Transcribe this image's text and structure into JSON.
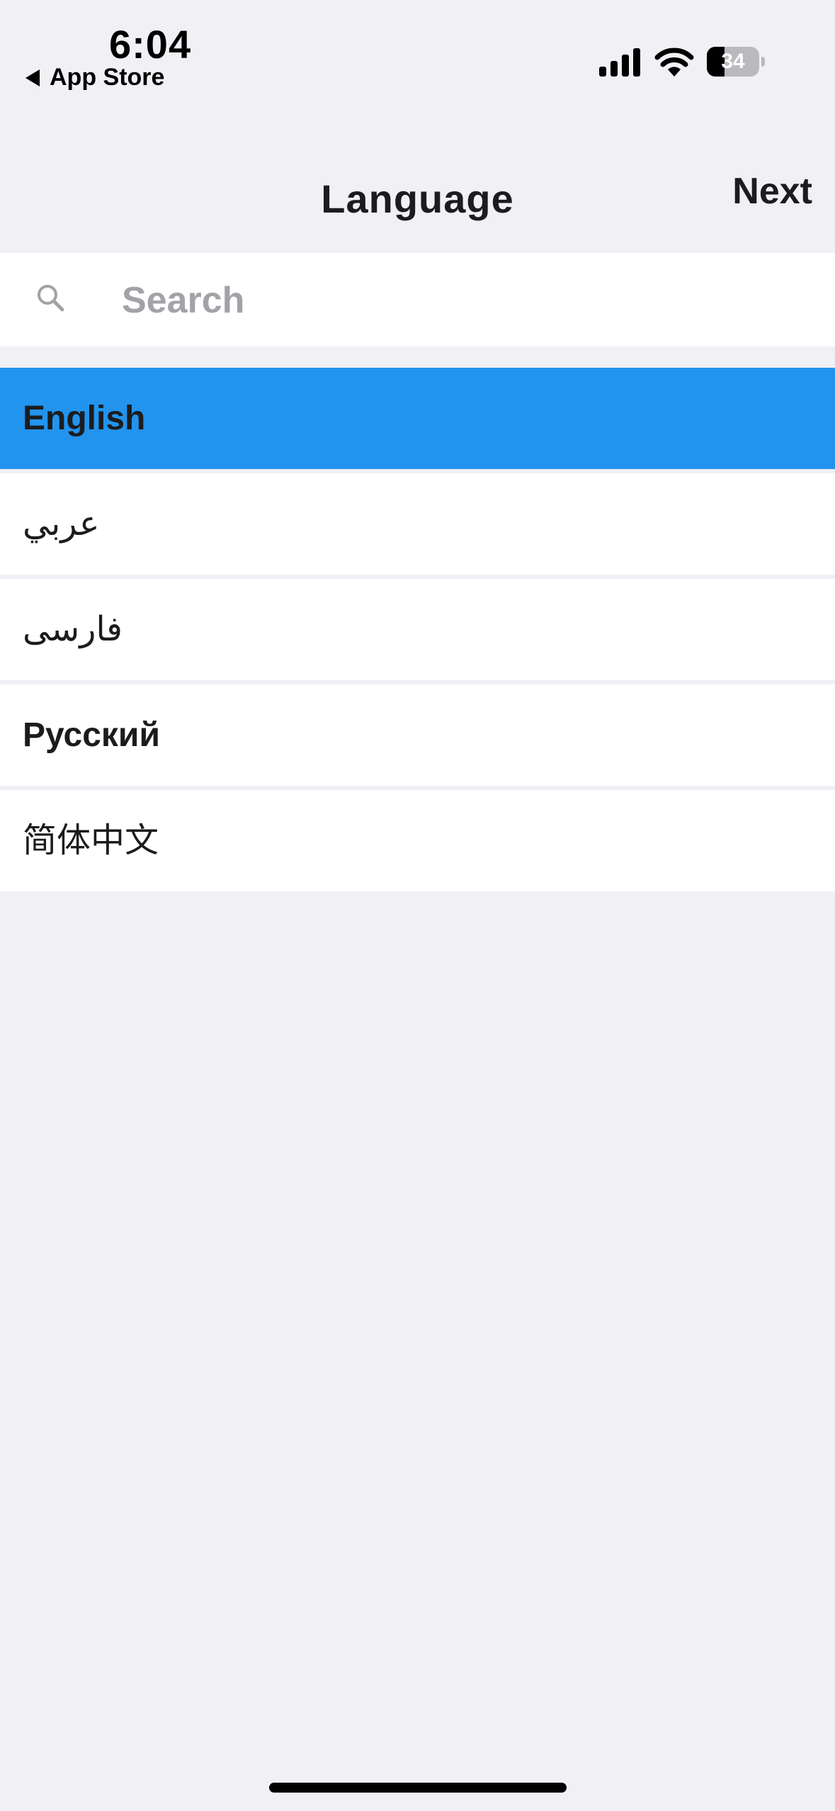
{
  "status_bar": {
    "time": "6:04",
    "back_app_label": "App Store",
    "battery_level": "34",
    "battery_fraction": 0.34
  },
  "nav": {
    "title": "Language",
    "next_label": "Next"
  },
  "search": {
    "placeholder": "Search",
    "value": ""
  },
  "languages": [
    {
      "label": "English",
      "selected": true,
      "bold": true
    },
    {
      "label": "عربي",
      "selected": false,
      "bold": false
    },
    {
      "label": "فارسی",
      "selected": false,
      "bold": false
    },
    {
      "label": "Русский",
      "selected": false,
      "bold": true
    },
    {
      "label": "简体中文",
      "selected": false,
      "bold": false
    }
  ],
  "colors": {
    "background": "#f0f0f5",
    "selected_row": "#2294ee",
    "row": "#ffffff",
    "text": "#1c1c1e",
    "placeholder": "#a2a2a7"
  },
  "icons": {
    "back": "back-triangle-icon",
    "signal": "cellular-signal-icon",
    "wifi": "wifi-icon",
    "battery": "battery-icon",
    "search": "search-icon"
  }
}
